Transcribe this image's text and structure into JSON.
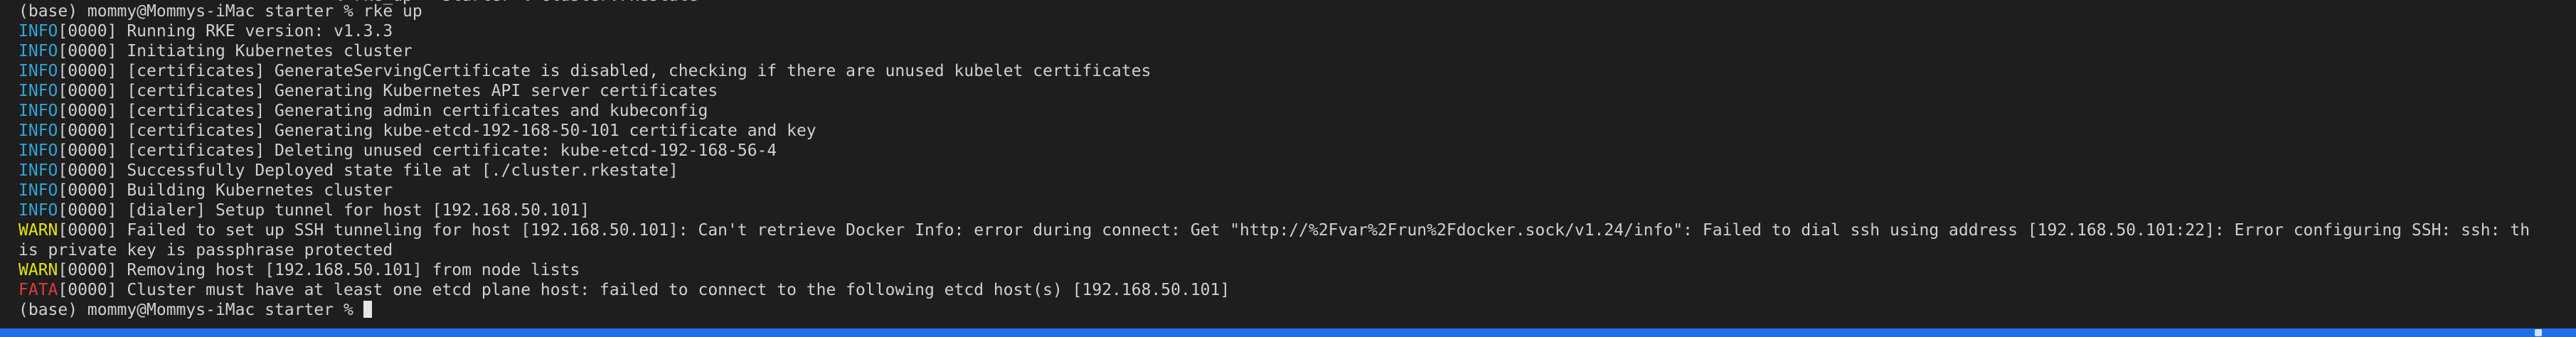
{
  "terminal": {
    "clipped_top_line": "                              ~ % rke_up   starter % cluster.rkestate",
    "prompt_lines": [
      "(base) mommy@Mommys-iMac starter % rke up"
    ],
    "log": [
      {
        "level": "INFO",
        "code": "[0000]",
        "text": " Running RKE version: v1.3.3"
      },
      {
        "level": "INFO",
        "code": "[0000]",
        "text": " Initiating Kubernetes cluster"
      },
      {
        "level": "INFO",
        "code": "[0000]",
        "text": " [certificates] GenerateServingCertificate is disabled, checking if there are unused kubelet certificates"
      },
      {
        "level": "INFO",
        "code": "[0000]",
        "text": " [certificates] Generating Kubernetes API server certificates"
      },
      {
        "level": "INFO",
        "code": "[0000]",
        "text": " [certificates] Generating admin certificates and kubeconfig"
      },
      {
        "level": "INFO",
        "code": "[0000]",
        "text": " [certificates] Generating kube-etcd-192-168-50-101 certificate and key"
      },
      {
        "level": "INFO",
        "code": "[0000]",
        "text": " [certificates] Deleting unused certificate: kube-etcd-192-168-56-4"
      },
      {
        "level": "INFO",
        "code": "[0000]",
        "text": " Successfully Deployed state file at [./cluster.rkestate]"
      },
      {
        "level": "INFO",
        "code": "[0000]",
        "text": " Building Kubernetes cluster"
      },
      {
        "level": "INFO",
        "code": "[0000]",
        "text": " [dialer] Setup tunnel for host [192.168.50.101]"
      },
      {
        "level": "WARN",
        "code": "[0000]",
        "text": " Failed to set up SSH tunneling for host [192.168.50.101]: Can't retrieve Docker Info: error during connect: Get \"http://%2Fvar%2Frun%2Fdocker.sock/v1.24/info\": Failed to dial ssh using address [192.168.50.101:22]: Error configuring SSH: ssh: th"
      },
      {
        "level": "",
        "code": "",
        "text": "is private key is passphrase protected"
      },
      {
        "level": "WARN",
        "code": "[0000]",
        "text": " Removing host [192.168.50.101] from node lists"
      },
      {
        "level": "FATA",
        "code": "[0000]",
        "text": " Cluster must have at least one etcd plane host: failed to connect to the following etcd host(s) [192.168.50.101]"
      }
    ],
    "final_prompt": "(base) mommy@Mommys-iMac starter % "
  },
  "colors": {
    "background": "#1e1e1e",
    "text": "#cfcfcf",
    "info": "#2fa6d6",
    "warn": "#e5e510",
    "fata": "#e23a3a",
    "status_bar": "#1f6feb"
  }
}
